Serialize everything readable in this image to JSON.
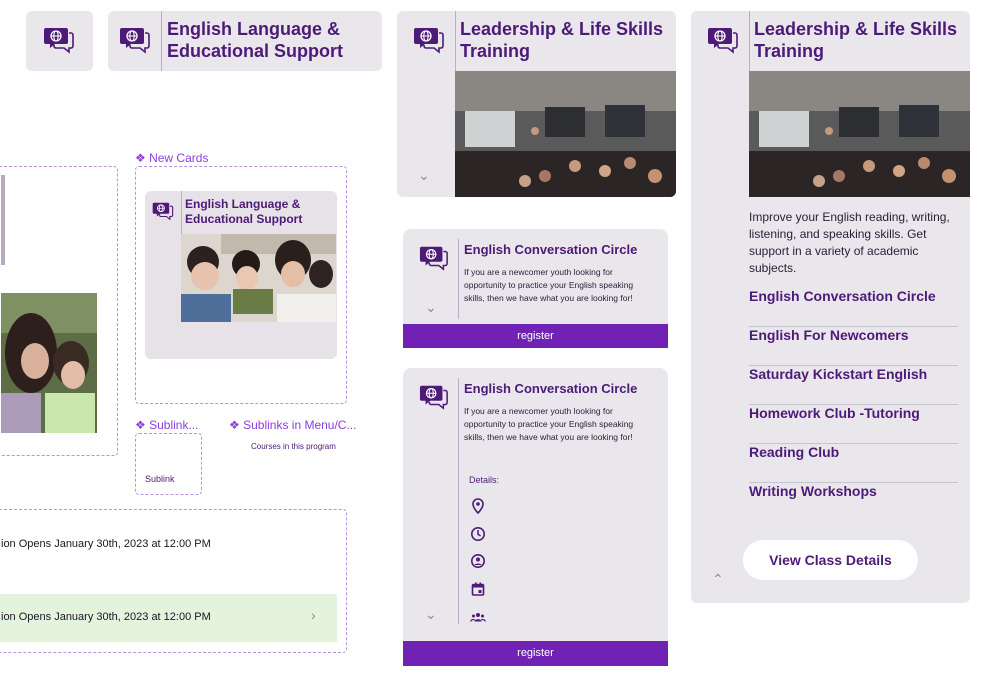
{
  "cards": {
    "icon_only": {},
    "english_header": {
      "title_line1": "English Language &",
      "title_line2": "Educational Support"
    },
    "leadership_collapsed": {
      "title_line1": "Leadership & Life Skills",
      "title_line2": "Training"
    },
    "leadership_expanded": {
      "title_line1": "Leadership & Life Skills",
      "title_line2": "Training",
      "description": "Improve your English reading, writing, listening, and speaking skills. Get support in a variety of academic subjects.",
      "links": [
        "English Conversation Circle",
        "English For Newcomers",
        "Saturday Kickstart English",
        "Homework Club -Tutoring",
        "Reading Club",
        "Writing Workshops"
      ],
      "view_button": "View Class Details"
    }
  },
  "annotations": {
    "new_cards": "❖ New Cards",
    "sublinks": "❖ Sublink...",
    "sublinks_menu": "❖ Sublinks in Menu/C...",
    "courses_caption": "Courses in this program",
    "sublink_label": "Sublink"
  },
  "mini_card": {
    "title_line1": "English Language &",
    "title_line2": "Educational Support"
  },
  "registration": {
    "row1": "ion Opens January 30th, 2023 at 12:00 PM",
    "row2": "ion Opens January 30th, 2023 at 12:00 PM"
  },
  "course_card_1": {
    "title": "English Conversation Circle",
    "body": "If you are a newcomer youth looking for opportunity to practice your English speaking skills, then we have what you are looking for!",
    "register": "register"
  },
  "course_card_2": {
    "title": "English Conversation Circle",
    "body": "If you are a newcomer youth looking for opportunity to practice your English speaking skills, then we have what you are looking for!",
    "details_label": "Details:",
    "detail_icons": [
      "location-pin-icon",
      "clock-icon",
      "person-icon",
      "calendar-icon",
      "group-icon"
    ],
    "register": "register"
  },
  "colors": {
    "brand_purple": "#4d1a78",
    "register_bar": "#6f22b3",
    "card_bg": "#e9e6ec",
    "highlight_green": "#e3f3dc"
  }
}
